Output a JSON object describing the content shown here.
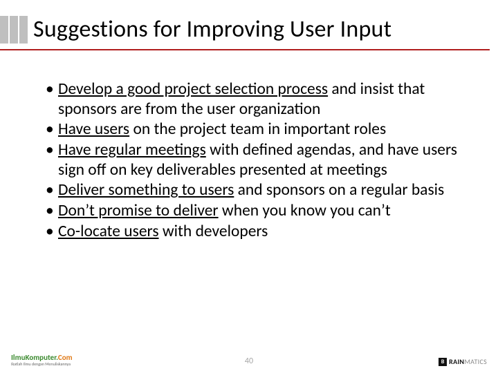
{
  "slide": {
    "title": "Suggestions for Improving User Input",
    "page_number": "40",
    "bullets": [
      {
        "u": "Develop a good project selection process",
        "rest": " and insist that sponsors are from the user organization"
      },
      {
        "u": "Have users",
        "rest": " on the project team in important roles"
      },
      {
        "u": "Have regular meetings",
        "rest": " with defined agendas, and have users sign off on key deliverables presented at meetings"
      },
      {
        "u": "Deliver something to users",
        "rest": " and sponsors on a regular basis"
      },
      {
        "u": "Don’t promise to deliver",
        "rest": " when you know you can’t"
      },
      {
        "u": "Co-locate users",
        "rest": " with developers"
      }
    ]
  },
  "footer": {
    "left_brand_1": "IlmuKomputer.",
    "left_brand_2": "Com",
    "left_tagline": "Ikatlah Ilmu dengan Menuliskannya",
    "right_brand_prefix": "B",
    "right_brand_main": "RAIN",
    "right_brand_suffix": "MATICS"
  }
}
